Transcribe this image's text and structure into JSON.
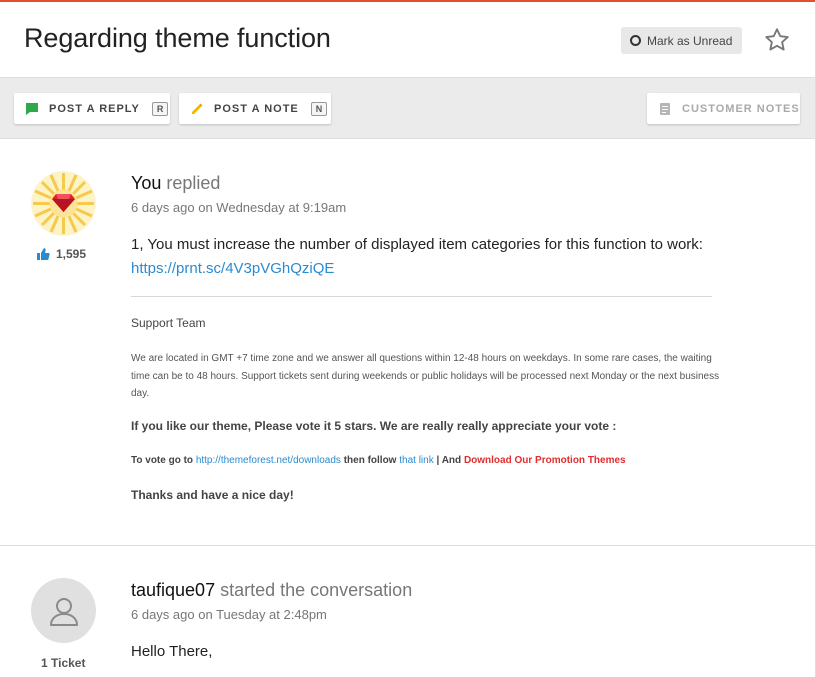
{
  "header": {
    "title": "Regarding theme function",
    "mark_unread_label": "Mark as Unread"
  },
  "toolbar": {
    "reply_label": "POST A REPLY",
    "reply_key": "R",
    "note_label": "POST A NOTE",
    "note_key": "N",
    "customer_notes_label": "CUSTOMER NOTES"
  },
  "messages": [
    {
      "author": "You",
      "action": "replied",
      "time_ago": "6 days ago",
      "time_detail": "on Wednesday at 9:19am",
      "likes": "1,595",
      "body_text": "1, You must increase the number of displayed item categories for this function to work:",
      "body_link": "https://prnt.sc/4V3pVGhQziQE",
      "signature": {
        "team": "Support Team",
        "location": "We are located in GMT +7 time zone and we answer all questions within 12-48 hours on weekdays. In some rare cases, the waiting time can be to 48 hours. Support tickets sent during weekends or public holidays will be processed next Monday or the next business day.",
        "vote": "If you like our theme, Please vote it 5 stars. We are really really appreciate your vote :",
        "go_prefix": "To vote go to",
        "go_link": "http://themeforest.net/downloads",
        "go_mid": "then follow",
        "go_link2": "that link",
        "go_sep": "| And",
        "go_promo": "Download Our Promotion Themes",
        "thanks": "Thanks and have a nice day!"
      }
    },
    {
      "author": "taufique07",
      "action": "started the conversation",
      "time_ago": "6 days ago",
      "time_detail": "on Tuesday at 2:48pm",
      "tickets": "1 Ticket",
      "body_text": "Hello There,"
    }
  ],
  "colors": {
    "accent": "#e2512e",
    "link": "#2a8bd0",
    "promo_red": "#e22d2d",
    "reply_icon_green": "#2ea84a",
    "note_icon_yellow": "#f5b800"
  }
}
